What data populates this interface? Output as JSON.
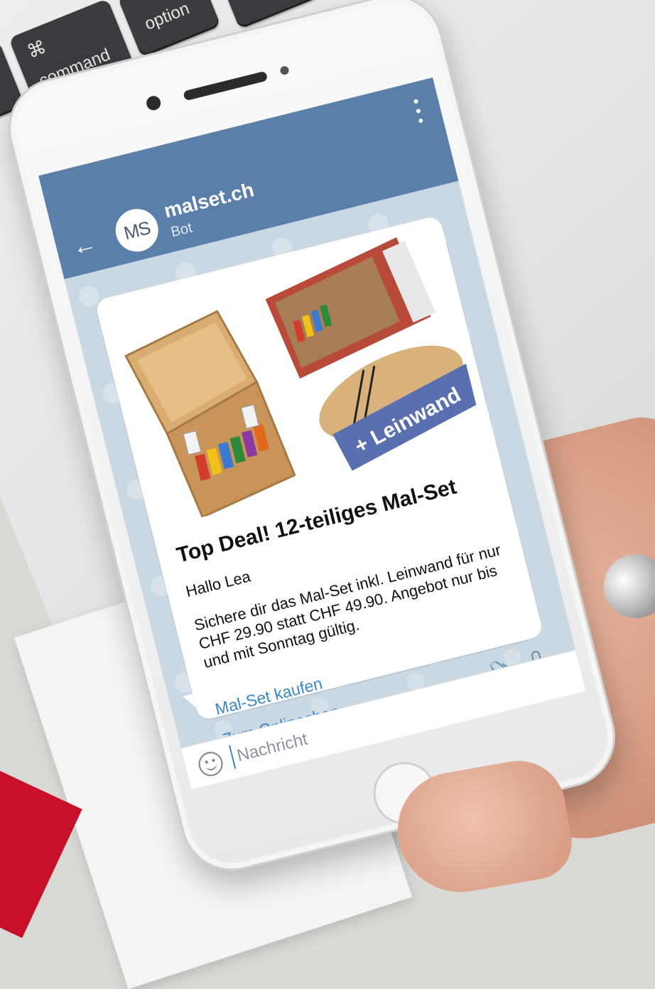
{
  "keyboard": {
    "command_glyph": "⌘",
    "command_label": "command",
    "option_label": "option"
  },
  "chat": {
    "name": "malset.ch",
    "subtitle": "Bot",
    "avatar_initials": "MS",
    "header_color": "#5a7fa8"
  },
  "message": {
    "image_overlay": "+ Leinwand",
    "title": "Top Deal! 12-teiliges Mal-Set",
    "greeting": "Hallo Lea",
    "body": "Sichere dir das Mal-Set inkl. Leinwand für nur CHF 29.90 statt CHF 49.90. Angebot nur bis und mit Sonntag gültig.",
    "link_buy": "Mal-Set kaufen",
    "link_shop": "Zum Onlineshop",
    "link_color": "#3b86c6"
  },
  "input": {
    "placeholder": "Nachricht"
  }
}
